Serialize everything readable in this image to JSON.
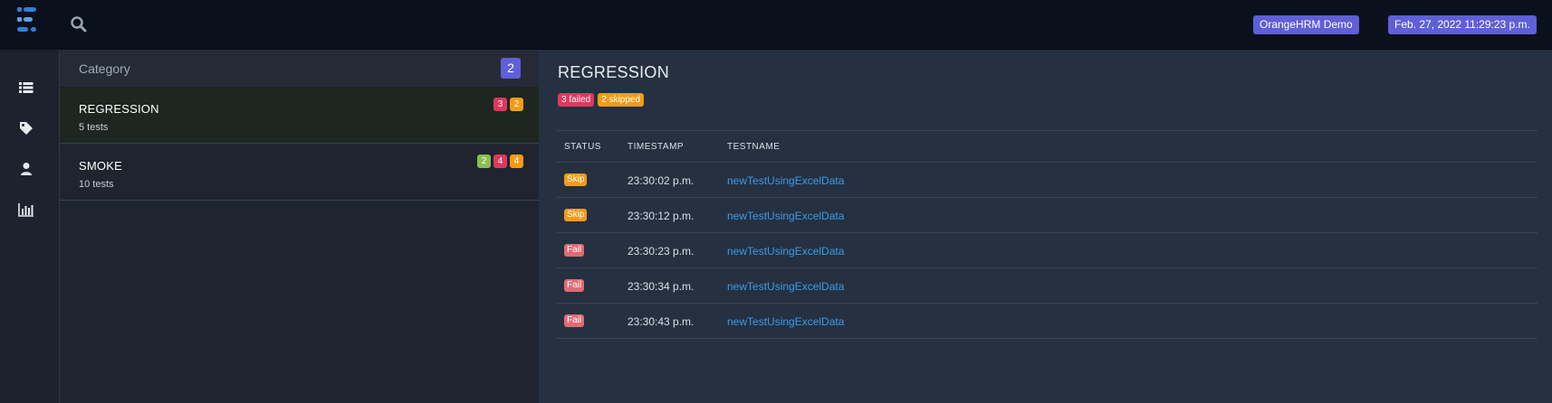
{
  "colors": {
    "accent": "#5f5fd8",
    "fail": "#e0375f",
    "skip": "#f29b17",
    "pass": "#89c04f",
    "fail_pill": "#e06b73",
    "link": "#3b9be8"
  },
  "header": {
    "logo_icon": "extent-logo-icon",
    "search_icon": "search-icon",
    "project_badge": "OrangeHRM Demo",
    "datetime_badge": "Feb. 27, 2022 11:29:23 p.m."
  },
  "leftnav": {
    "items": [
      {
        "icon": "list-icon"
      },
      {
        "icon": "tag-icon"
      },
      {
        "icon": "user-icon"
      },
      {
        "icon": "bar-chart-icon"
      }
    ]
  },
  "categories": {
    "header_label": "Category",
    "count": "2",
    "items": [
      {
        "name": "REGRESSION",
        "sub": "5 tests",
        "badges": [
          {
            "value": "3",
            "kind": "fail"
          },
          {
            "value": "2",
            "kind": "skip"
          }
        ]
      },
      {
        "name": "SMOKE",
        "sub": "10 tests",
        "badges": [
          {
            "value": "2",
            "kind": "pass"
          },
          {
            "value": "4",
            "kind": "fail"
          },
          {
            "value": "4",
            "kind": "skip"
          }
        ]
      }
    ]
  },
  "detail": {
    "title": "REGRESSION",
    "failed_badge": "3 failed",
    "skipped_badge": "2 skipped",
    "columns": {
      "status": "STATUS",
      "timestamp": "TIMESTAMP",
      "testname": "TESTNAME"
    },
    "rows": [
      {
        "status": "Skip",
        "kind": "skip",
        "timestamp": "23:30:02 p.m.",
        "testname": "newTestUsingExcelData"
      },
      {
        "status": "Skip",
        "kind": "skip",
        "timestamp": "23:30:12 p.m.",
        "testname": "newTestUsingExcelData"
      },
      {
        "status": "Fail",
        "kind": "fail",
        "timestamp": "23:30:23 p.m.",
        "testname": "newTestUsingExcelData"
      },
      {
        "status": "Fail",
        "kind": "fail",
        "timestamp": "23:30:34 p.m.",
        "testname": "newTestUsingExcelData"
      },
      {
        "status": "Fail",
        "kind": "fail",
        "timestamp": "23:30:43 p.m.",
        "testname": "newTestUsingExcelData"
      }
    ]
  }
}
